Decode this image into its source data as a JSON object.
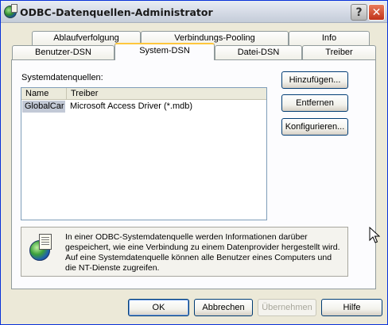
{
  "window": {
    "title": "ODBC-Datenquellen-Administrator",
    "help_glyph": "?",
    "close_glyph": "✕"
  },
  "tabs": {
    "row_top": [
      {
        "label": "Ablaufverfolgung"
      },
      {
        "label": "Verbindungs-Pooling"
      },
      {
        "label": "Info"
      }
    ],
    "row_bottom": [
      {
        "label": "Benutzer-DSN"
      },
      {
        "label": "System-DSN",
        "active": true
      },
      {
        "label": "Datei-DSN"
      },
      {
        "label": "Treiber"
      }
    ]
  },
  "system_dsn": {
    "list_label": "Systemdatenquellen:",
    "columns": [
      "Name",
      "Treiber"
    ],
    "rows": [
      {
        "name": "GlobalCar",
        "driver": "Microsoft Access Driver (*.mdb)",
        "selected": true
      }
    ],
    "buttons": {
      "add": "Hinzufügen...",
      "remove": "Entfernen",
      "configure": "Konfigurieren..."
    },
    "info_lines": [
      "In einer ODBC-Systemdatenquelle werden Informationen darüber",
      "gespeichert, wie eine Verbindung zu einem Datenprovider hergestellt wird.",
      "Auf eine Systemdatenquelle können alle Benutzer eines Computers und",
      "die NT-Dienste  zugreifen."
    ]
  },
  "footer": {
    "ok": "OK",
    "cancel": "Abbrechen",
    "apply": "Übernehmen",
    "help": "Hilfe"
  },
  "icons": {
    "title": "odbc-globe-icon",
    "info": "odbc-info-icon",
    "cursor": "mouse-pointer-icon"
  },
  "colors": {
    "titlebar": "#d8dde8",
    "dialog_bg": "#ece9d8",
    "active_tab_accent": "#ffc73c",
    "selection": "#c2c9d6",
    "close_button": "#c0321a"
  }
}
